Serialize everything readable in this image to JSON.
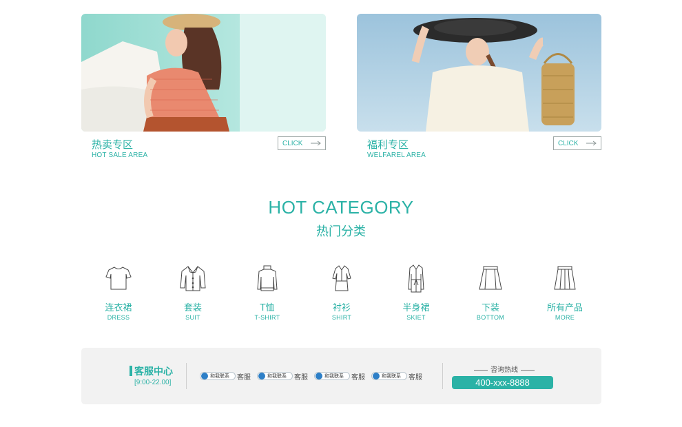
{
  "promos": [
    {
      "title": "热卖专区",
      "subtitle": "HOT SALE AREA",
      "button": "CLICK"
    },
    {
      "title": "福利专区",
      "subtitle": "WELFAREL AREA",
      "button": "CLICK"
    }
  ],
  "category": {
    "title": "HOT CATEGORY",
    "subtitle": "热门分类",
    "items": [
      {
        "cn": "连衣裙",
        "en": "DRESS",
        "icon": "tshirt-icon"
      },
      {
        "cn": "套装",
        "en": "SUIT",
        "icon": "blouse-icon"
      },
      {
        "cn": "T恤",
        "en": "T-SHIRT",
        "icon": "sweater-icon"
      },
      {
        "cn": "衬衫",
        "en": "SHIRT",
        "icon": "dress-icon"
      },
      {
        "cn": "半身裙",
        "en": "SKIET",
        "icon": "coat-icon"
      },
      {
        "cn": "下装",
        "en": "BOTTOM",
        "icon": "skirt-icon"
      },
      {
        "cn": "所有产品",
        "en": "MORE",
        "icon": "pleated-skirt-icon"
      }
    ]
  },
  "footer": {
    "service_title": "客服中心",
    "service_hours": "[9:00-22.00]",
    "qq_links": [
      {
        "badge": "和我联系",
        "label": "客服"
      },
      {
        "badge": "和我联系",
        "label": "客服"
      },
      {
        "badge": "和我联系",
        "label": "客服"
      },
      {
        "badge": "和我联系",
        "label": "客服"
      }
    ],
    "hotline_label": "咨询热线",
    "hotline_number": "400-xxx-8888"
  },
  "colors": {
    "accent": "#2bb2a6",
    "footer_bg": "#f2f2f2"
  }
}
